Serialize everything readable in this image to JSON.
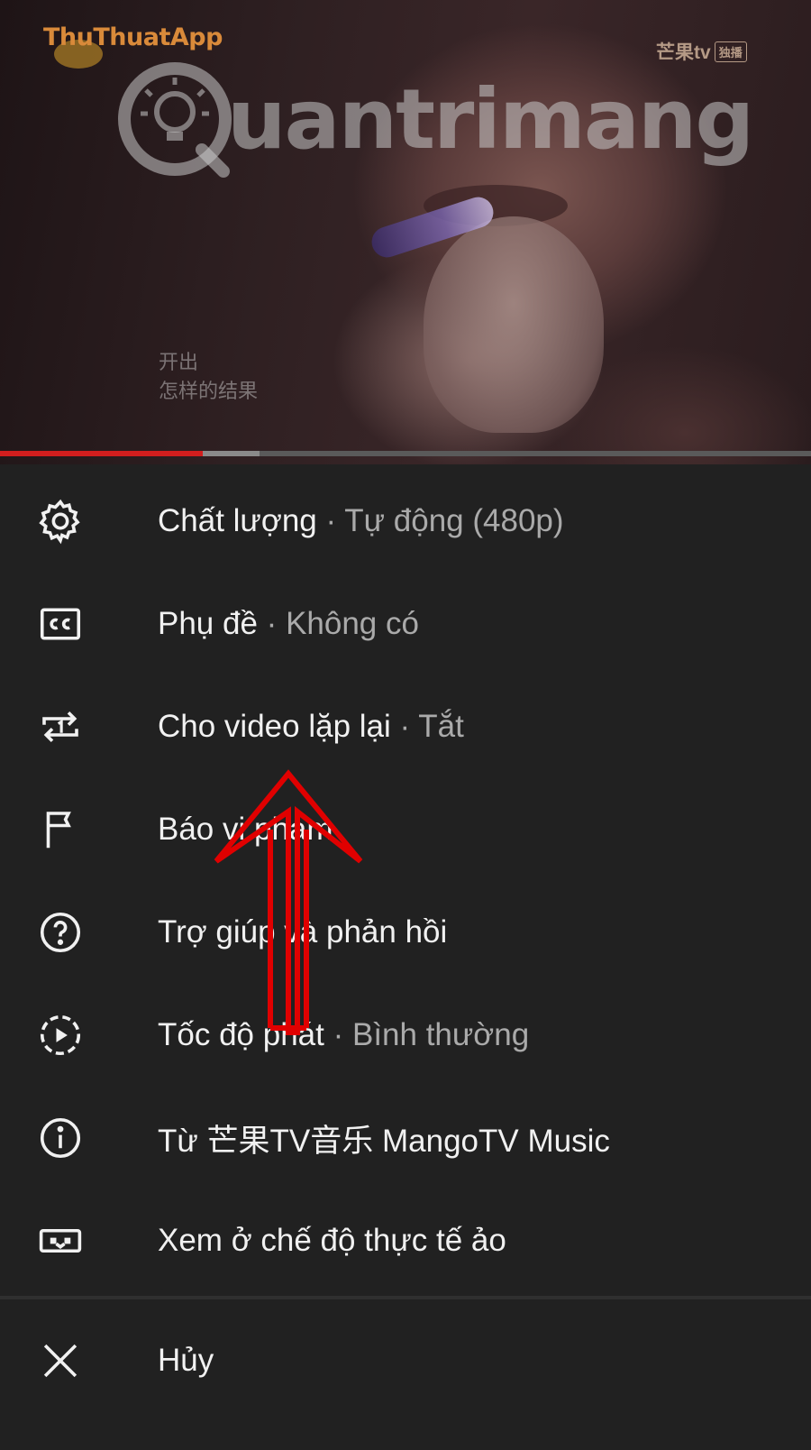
{
  "video": {
    "site_logo": "ThuThuatApp",
    "channel_logo": "芒果tv",
    "channel_tag": "独播",
    "watermark": "uantrimang",
    "subtitle_line1": "开出",
    "subtitle_line2": "怎样的结果",
    "progress_fraction": 0.25,
    "buffer_fraction": 0.32
  },
  "menu": {
    "items": [
      {
        "label": "Chất lượng",
        "sub": "Tự động (480p)",
        "icon": "gear-icon"
      },
      {
        "label": "Phụ đề",
        "sub": "Không có",
        "icon": "cc-icon"
      },
      {
        "label": "Cho video lặp lại",
        "sub": "Tắt",
        "icon": "repeat-one-icon"
      },
      {
        "label": "Báo vi phạm",
        "sub": "",
        "icon": "flag-icon"
      },
      {
        "label": "Trợ giúp và phản hồi",
        "sub": "",
        "icon": "help-icon"
      },
      {
        "label": "Tốc độ phát",
        "sub": "Bình thường",
        "icon": "playback-speed-icon"
      },
      {
        "label": "Từ 芒果TV音乐 MangoTV Music",
        "sub": "",
        "icon": "info-icon"
      },
      {
        "label": "Xem ở chế độ thực tế ảo",
        "sub": "",
        "icon": "vr-icon"
      }
    ],
    "separator": "·",
    "cancel_label": "Hủy"
  },
  "colors": {
    "sheet_bg": "#212121",
    "text_primary": "#f1f1f1",
    "text_secondary": "#aaaaaa",
    "progress_red": "#d21e1e",
    "annotation_arrow": "#e00000"
  }
}
